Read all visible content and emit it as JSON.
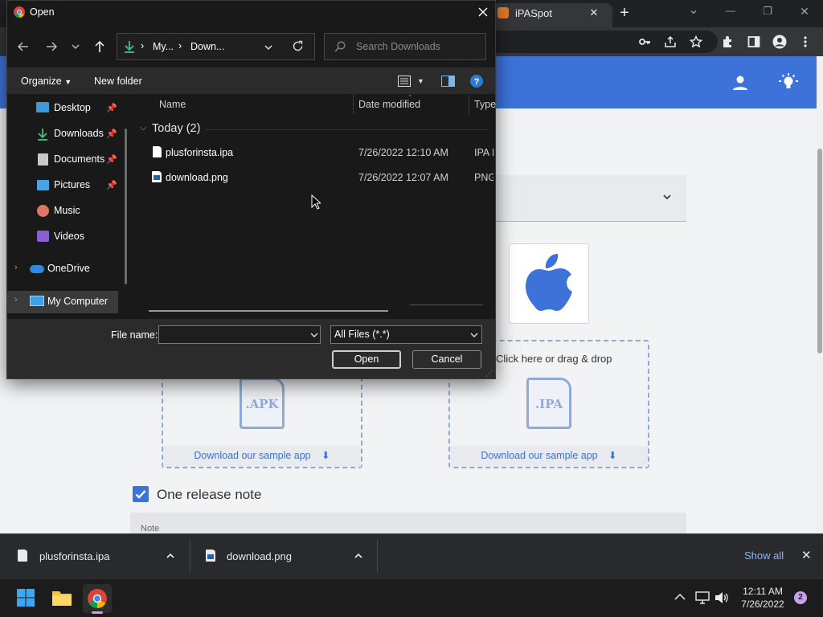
{
  "browser": {
    "tab_title": "iPASpot",
    "new_tab": "+",
    "min": "—",
    "restore": "❐",
    "close": "✕",
    "tab_close": "✕",
    "tabs_dropdown": "⌄"
  },
  "site": {
    "dropdown_chevron": "⌄",
    "upload_prompt": "Click here or drag & drop",
    "apk_label": ".APK",
    "ipa_label": ".IPA",
    "sample_link": "Download our sample app",
    "release_note_label": "One release note",
    "note_label": "Note",
    "accent": "#3d73d9"
  },
  "dialog": {
    "title": "Open",
    "breadcrumb": [
      "My...",
      "Down..."
    ],
    "search_placeholder": "Search Downloads",
    "organize": "Organize",
    "new_folder": "New folder",
    "help": "?",
    "nav": [
      {
        "label": "Desktop",
        "icon": "desktop-icon"
      },
      {
        "label": "Downloads",
        "icon": "download-icon"
      },
      {
        "label": "Documents",
        "icon": "document-icon"
      },
      {
        "label": "Pictures",
        "icon": "pictures-icon"
      },
      {
        "label": "Music",
        "icon": "music-icon"
      },
      {
        "label": "Videos",
        "icon": "videos-icon"
      },
      {
        "label": "OneDrive",
        "icon": "cloud-icon"
      },
      {
        "label": "My Computer",
        "icon": "computer-icon"
      }
    ],
    "columns": {
      "name": "Name",
      "date": "Date modified",
      "type": "Type"
    },
    "group": "Today (2)",
    "files": [
      {
        "name": "plusforinsta.ipa",
        "date": "7/26/2022 12:10 AM",
        "type": "IPA F"
      },
      {
        "name": "download.png",
        "date": "7/26/2022 12:07 AM",
        "type": "PNG"
      }
    ],
    "file_name_label": "File name:",
    "file_name_value": "",
    "filter": "All Files (*.*)",
    "open_button": "Open",
    "cancel_button": "Cancel"
  },
  "shelf": {
    "items": [
      "plusforinsta.ipa",
      "download.png"
    ],
    "show_all": "Show all",
    "close": "✕"
  },
  "taskbar": {
    "time": "12:11 AM",
    "date": "7/26/2022",
    "notifications": "2"
  }
}
